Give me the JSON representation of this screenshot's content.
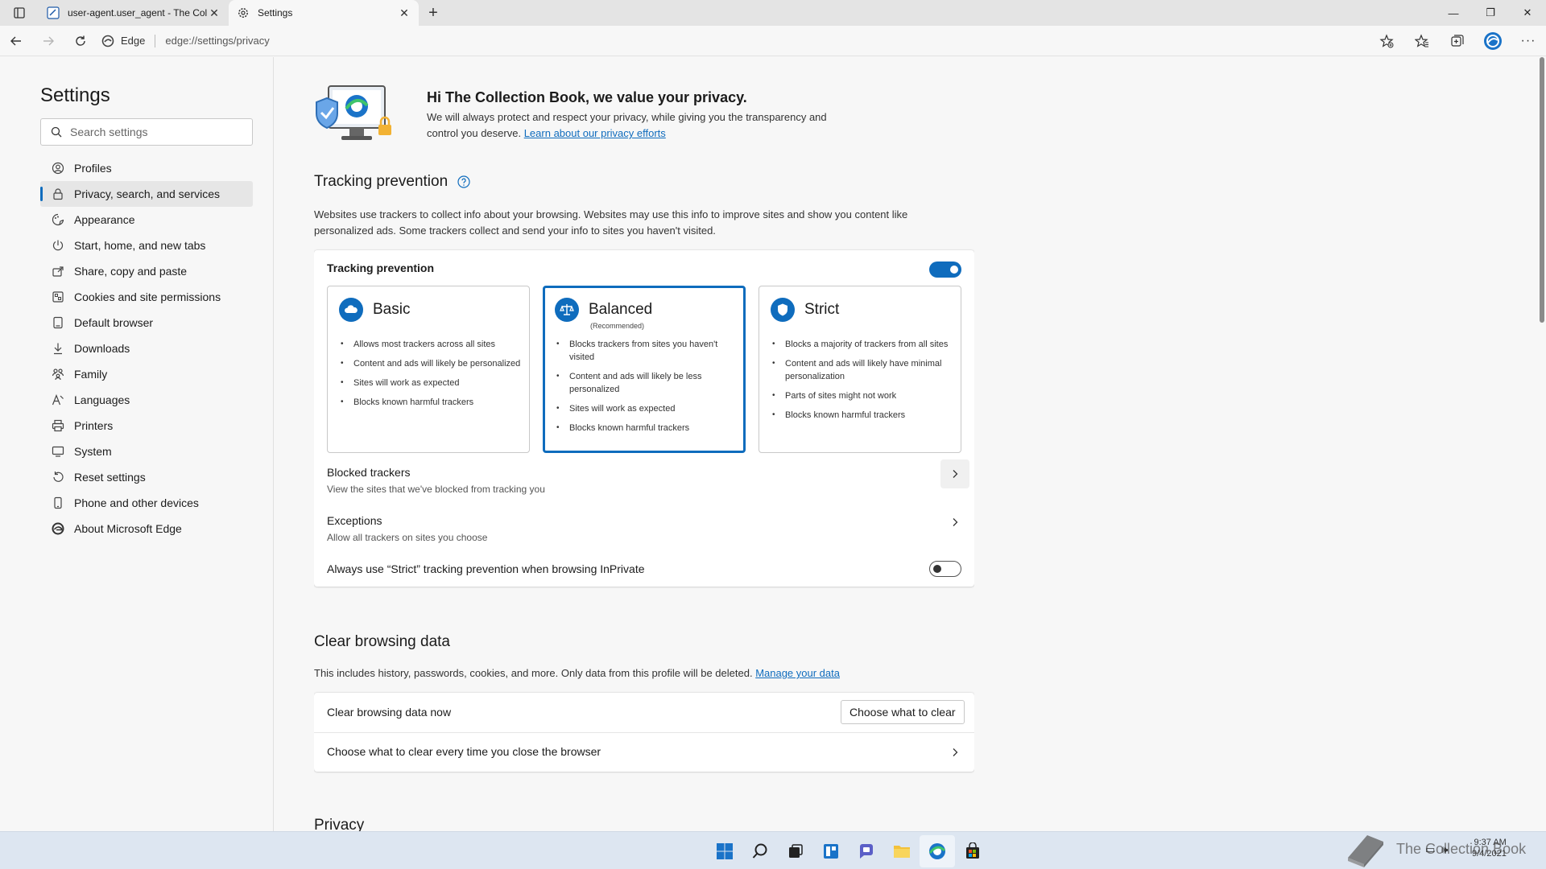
{
  "browser": {
    "tabs": [
      {
        "title": "user-agent.user_agent - The Coll",
        "active": false
      },
      {
        "title": "Settings",
        "active": true
      }
    ],
    "address": {
      "site_label": "Edge",
      "url": "edge://settings/privacy"
    }
  },
  "sidebar": {
    "title": "Settings",
    "search_placeholder": "Search settings",
    "items": [
      {
        "label": "Profiles",
        "icon": "profile-icon"
      },
      {
        "label": "Privacy, search, and services",
        "icon": "lock-icon",
        "selected": true
      },
      {
        "label": "Appearance",
        "icon": "appearance-icon"
      },
      {
        "label": "Start, home, and new tabs",
        "icon": "power-icon"
      },
      {
        "label": "Share, copy and paste",
        "icon": "share-icon"
      },
      {
        "label": "Cookies and site permissions",
        "icon": "cookies-icon"
      },
      {
        "label": "Default browser",
        "icon": "browser-icon"
      },
      {
        "label": "Downloads",
        "icon": "download-icon"
      },
      {
        "label": "Family",
        "icon": "family-icon"
      },
      {
        "label": "Languages",
        "icon": "language-icon"
      },
      {
        "label": "Printers",
        "icon": "printer-icon"
      },
      {
        "label": "System",
        "icon": "system-icon"
      },
      {
        "label": "Reset settings",
        "icon": "reset-icon"
      },
      {
        "label": "Phone and other devices",
        "icon": "phone-icon"
      },
      {
        "label": "About Microsoft Edge",
        "icon": "edge-icon"
      }
    ]
  },
  "hero": {
    "title": "Hi The Collection Book, we value your privacy.",
    "desc": "We will always protect and respect your privacy, while giving you the transparency and control you deserve.",
    "link": "Learn about our privacy efforts"
  },
  "tracking": {
    "section_title": "Tracking prevention",
    "desc": "Websites use trackers to collect info about your browsing. Websites may use this info to improve sites and show you content like personalized ads. Some trackers collect and send your info to sites you haven't visited.",
    "card_title": "Tracking prevention",
    "enabled": true,
    "levels": {
      "basic": {
        "name": "Basic",
        "bullets": [
          "Allows most trackers across all sites",
          "Content and ads will likely be personalized",
          "Sites will work as expected",
          "Blocks known harmful trackers"
        ]
      },
      "balanced": {
        "name": "Balanced",
        "sub": "(Recommended)",
        "selected": true,
        "bullets": [
          "Blocks trackers from sites you haven't visited",
          "Content and ads will likely be less personalized",
          "Sites will work as expected",
          "Blocks known harmful trackers"
        ]
      },
      "strict": {
        "name": "Strict",
        "bullets": [
          "Blocks a majority of trackers from all sites",
          "Content and ads will likely have minimal personalization",
          "Parts of sites might not work",
          "Blocks known harmful trackers"
        ]
      }
    },
    "blocked": {
      "title": "Blocked trackers",
      "sub": "View the sites that we've blocked from tracking you"
    },
    "exceptions": {
      "title": "Exceptions",
      "sub": "Allow all trackers on sites you choose"
    },
    "inprivate": {
      "title": "Always use “Strict” tracking prevention when browsing InPrivate",
      "enabled": false
    }
  },
  "clear": {
    "section_title": "Clear browsing data",
    "desc": "This includes history, passwords, cookies, and more. Only data from this profile will be deleted.",
    "link": "Manage your data",
    "now_label": "Clear browsing data now",
    "button": "Choose what to clear",
    "every_time": "Choose what to clear every time you close the browser"
  },
  "privacy": {
    "section_title": "Privacy"
  },
  "taskbar": {
    "watermark": "The Collection Book",
    "time": "9:37 AM",
    "date": "9/4/2021"
  },
  "colors": {
    "accent": "#0f6cbd"
  }
}
